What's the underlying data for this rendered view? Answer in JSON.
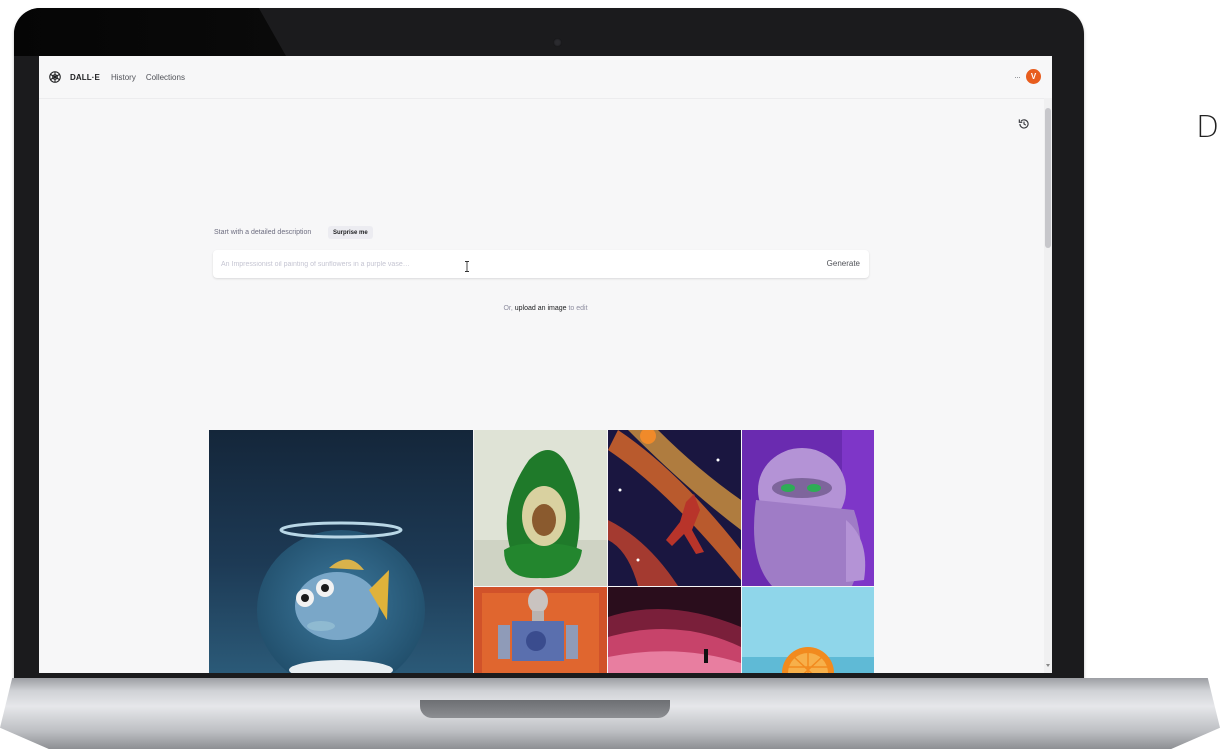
{
  "side_text": "D",
  "nav": {
    "brand": "DALL·E",
    "links": [
      "History",
      "Collections"
    ],
    "more_label": "···",
    "avatar_initial": "V"
  },
  "prompt": {
    "label": "Start with a detailed description",
    "surprise_label": "Surprise me",
    "placeholder": "An Impressionist oil painting of sunflowers in a purple vase…",
    "generate_label": "Generate"
  },
  "upload": {
    "prefix": "Or,",
    "link_text": "upload an image",
    "suffix": "to edit"
  },
  "gallery": {
    "images": [
      "fish-in-bowl",
      "avocado-chair",
      "astronaut-in-space",
      "purple-monster",
      "robot-painting",
      "dark-dune",
      "orange-slice"
    ]
  },
  "colors": {
    "avatar": "#e85d1e",
    "page_bg": "#f7f7f8"
  }
}
